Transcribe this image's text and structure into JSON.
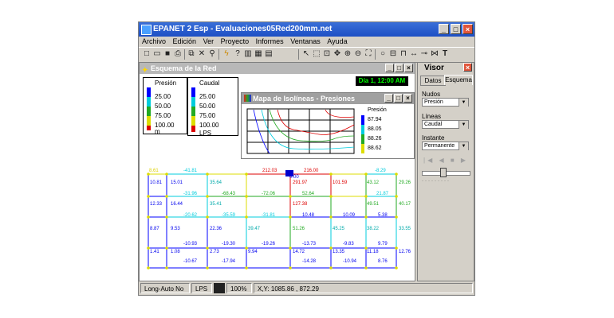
{
  "app": {
    "title": "EPANET 2 Esp - Evaluaciones05Red200mm.net",
    "min_icon": "_",
    "max_icon": "□",
    "close_icon": "×"
  },
  "menu": [
    "Archivo",
    "Edición",
    "Ver",
    "Proyecto",
    "Informes",
    "Ventanas",
    "Ayuda"
  ],
  "network_window": {
    "title": "Esquema de la Red",
    "time_label": "Día 1, 12:00 AM",
    "node_legend": {
      "title": "Presión",
      "values": [
        "25.00",
        "50.00",
        "75.00",
        "100.00"
      ],
      "unit": "m"
    },
    "link_legend": {
      "title": "Caudal",
      "values": [
        "25.00",
        "50.00",
        "75.00",
        "100.00"
      ],
      "unit": "LPS"
    },
    "labels": [
      {
        "t": "8.61"
      },
      {
        "t": "-41.81"
      },
      {
        "t": "212.03"
      },
      {
        "t": "216.00"
      },
      {
        "t": "-8.29"
      },
      {
        "t": "10.81"
      },
      {
        "t": "15.01"
      },
      {
        "t": "35.64"
      },
      {
        "t": "0.00"
      },
      {
        "t": "291.97"
      },
      {
        "t": "101.59"
      },
      {
        "t": "43.12"
      },
      {
        "t": "29.26"
      },
      {
        "t": "-31.96"
      },
      {
        "t": "-68.43"
      },
      {
        "t": "-72.06"
      },
      {
        "t": "52.64"
      },
      {
        "t": "21.87"
      },
      {
        "t": "12.33"
      },
      {
        "t": "16.44"
      },
      {
        "t": "35.41"
      },
      {
        "t": "127.38"
      },
      {
        "t": "49.51"
      },
      {
        "t": "40.17"
      },
      {
        "t": "-20.62"
      },
      {
        "t": "-35.59"
      },
      {
        "t": "-31.81"
      },
      {
        "t": "10.48"
      },
      {
        "t": "10.09"
      },
      {
        "t": "5.38"
      },
      {
        "t": "8.87"
      },
      {
        "t": "9.53"
      },
      {
        "t": "22.36"
      },
      {
        "t": "39.47"
      },
      {
        "t": "51.26"
      },
      {
        "t": "45.25"
      },
      {
        "t": "38.22"
      },
      {
        "t": "33.55"
      },
      {
        "t": "-10.93"
      },
      {
        "t": "-19.30"
      },
      {
        "t": "-19.26"
      },
      {
        "t": "-13.73"
      },
      {
        "t": "-9.83"
      },
      {
        "t": "9.79"
      },
      {
        "t": "1.41"
      },
      {
        "t": "1.08"
      },
      {
        "t": "2.73"
      },
      {
        "t": "9.94"
      },
      {
        "t": "14.72"
      },
      {
        "t": "13.35"
      },
      {
        "t": "11.18"
      },
      {
        "t": "12.76"
      },
      {
        "t": "-10.67"
      },
      {
        "t": "-17.94"
      },
      {
        "t": "-14.28"
      },
      {
        "t": "-10.94"
      },
      {
        "t": "8.76"
      }
    ]
  },
  "contour_window": {
    "title": "Mapa de Isolíneas - Presiones",
    "legend_title": "Presión",
    "values": [
      "87.94",
      "88.05",
      "88.26",
      "88.62"
    ]
  },
  "visor": {
    "title": "Visor",
    "tabs": [
      "Datos",
      "Esquema"
    ],
    "nodes_label": "Nudos",
    "nodes_value": "Presión",
    "links_label": "Líneas",
    "links_value": "Caudal",
    "time_label": "Instante",
    "time_value": "Permanente"
  },
  "status": {
    "auto_length": "Long-Auto No",
    "flow_units": "LPS",
    "zoom": "100%",
    "coords": "X,Y: 1085.86 , 872.29"
  },
  "colors": {
    "blue": "#0000ff",
    "cyan": "#00ccdd",
    "green": "#22aa22",
    "yellow": "#dddd00",
    "red": "#dd0000"
  }
}
